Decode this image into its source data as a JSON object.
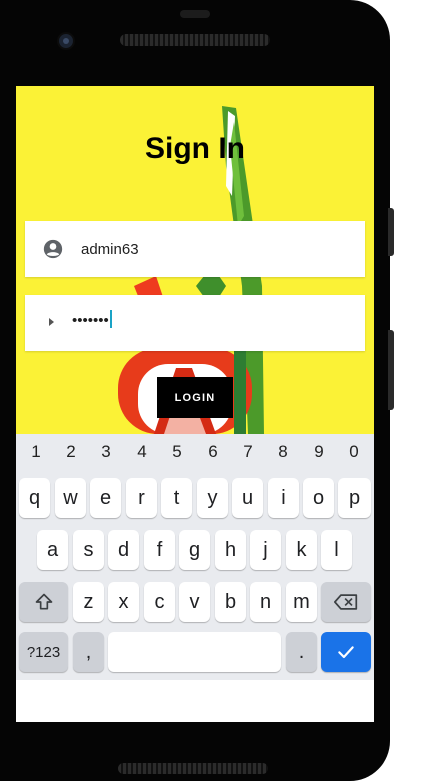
{
  "screen": {
    "title": "Sign In",
    "username_value": "admin63",
    "password_value": "•••••••",
    "login_label": "LOGIN"
  },
  "colors": {
    "app_background": "#fbf236",
    "button_background": "#000000",
    "keyboard_background": "#e9ebef",
    "enter_key": "#1a73e8",
    "cursor": "#1aa3c6"
  },
  "icons": {
    "username": "account-circle-icon",
    "password": "right-arrow-icon",
    "shift": "shift-icon",
    "backspace": "backspace-icon",
    "enter": "checkmark-icon"
  },
  "keyboard": {
    "number_row": [
      "1",
      "2",
      "3",
      "4",
      "5",
      "6",
      "7",
      "8",
      "9",
      "0"
    ],
    "row1": [
      "q",
      "w",
      "e",
      "r",
      "t",
      "y",
      "u",
      "i",
      "o",
      "p"
    ],
    "row2": [
      "a",
      "s",
      "d",
      "f",
      "g",
      "h",
      "j",
      "k",
      "l"
    ],
    "row3": [
      "z",
      "x",
      "c",
      "v",
      "b",
      "n",
      "m"
    ],
    "symbols_label": "?123",
    "comma_label": ",",
    "period_label": "."
  }
}
